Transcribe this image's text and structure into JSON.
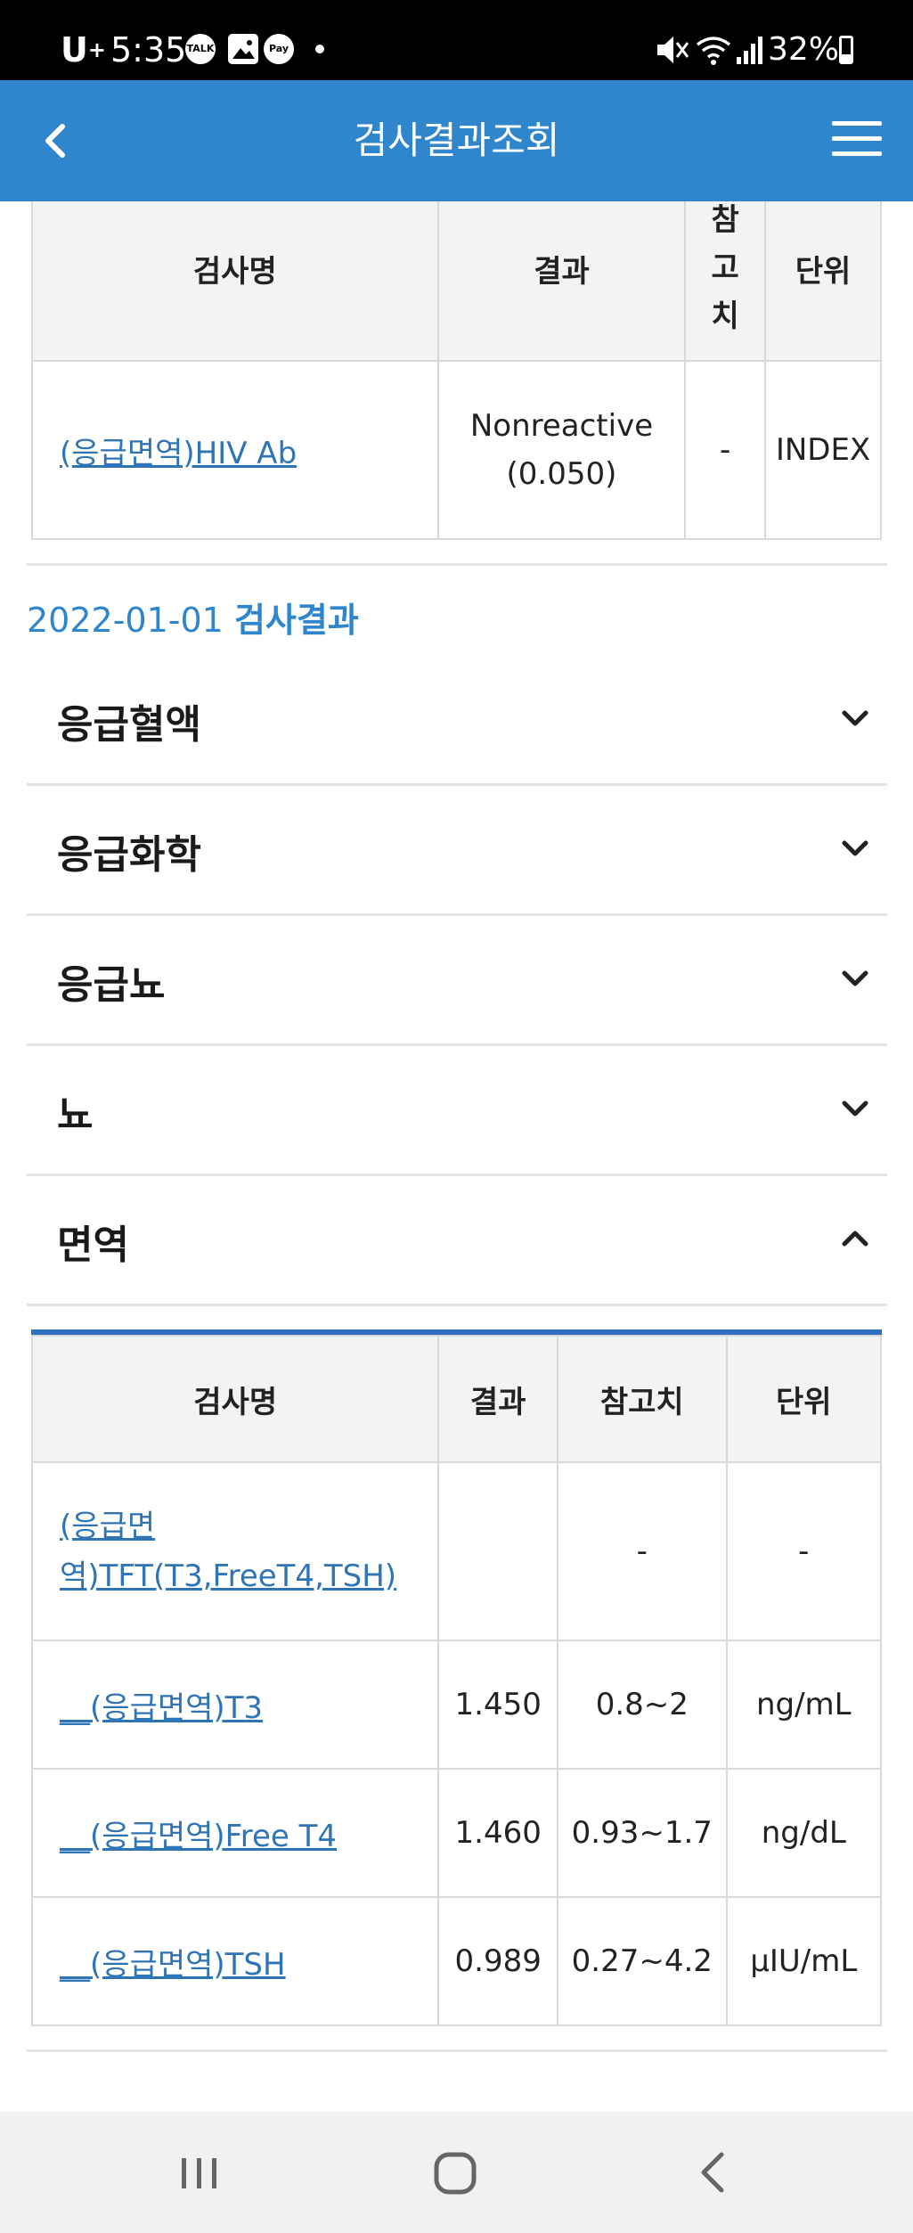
{
  "status_bar": {
    "carrier": "U",
    "carrier_sup": "+",
    "time": "5:35",
    "notif_talk": "TALK",
    "notif_pay": "Pay",
    "battery_pct": "32%"
  },
  "header": {
    "title": "검사결과조회"
  },
  "table1": {
    "headers": [
      "검사명",
      "결과",
      "참고치",
      "단위"
    ],
    "ref_header_partial_top": "참",
    "ref_header_line2": "고",
    "ref_header_line3": "치",
    "rows": [
      {
        "name": "(응급면역)HIV Ab",
        "result_line1": "Nonreactive",
        "result_line2": "(0.050)",
        "ref": "-",
        "unit": "INDEX"
      }
    ]
  },
  "results_section": {
    "date": "2022-01-01",
    "suffix": "검사결과"
  },
  "accordions": [
    {
      "label": "응급혈액",
      "expanded": false
    },
    {
      "label": "응급화학",
      "expanded": false
    },
    {
      "label": "응급뇨",
      "expanded": false
    },
    {
      "label": "뇨",
      "expanded": false
    },
    {
      "label": "면역",
      "expanded": true
    }
  ],
  "table2": {
    "headers": [
      "검사명",
      "결과",
      "참고치",
      "단위"
    ],
    "rows": [
      {
        "name_line1": "(응급면",
        "name_line2": "역)TFT(T3,FreeT4,TSH)",
        "result": "",
        "ref": "-",
        "unit": "-"
      },
      {
        "name": "__(응급면역)T3",
        "result": "1.450",
        "ref": "0.8~2",
        "unit": "ng/mL"
      },
      {
        "name": "__(응급면역)Free T4",
        "result": "1.460",
        "ref": "0.93~1.7",
        "unit": "ng/dL"
      },
      {
        "name": "__(응급면역)TSH",
        "result": "0.989",
        "ref": "0.27~4.2",
        "unit": "µIU/mL"
      }
    ]
  },
  "colors": {
    "header_bg": "#2f86cc",
    "link": "#2f74b5",
    "accent_line": "#2f6fc0"
  }
}
